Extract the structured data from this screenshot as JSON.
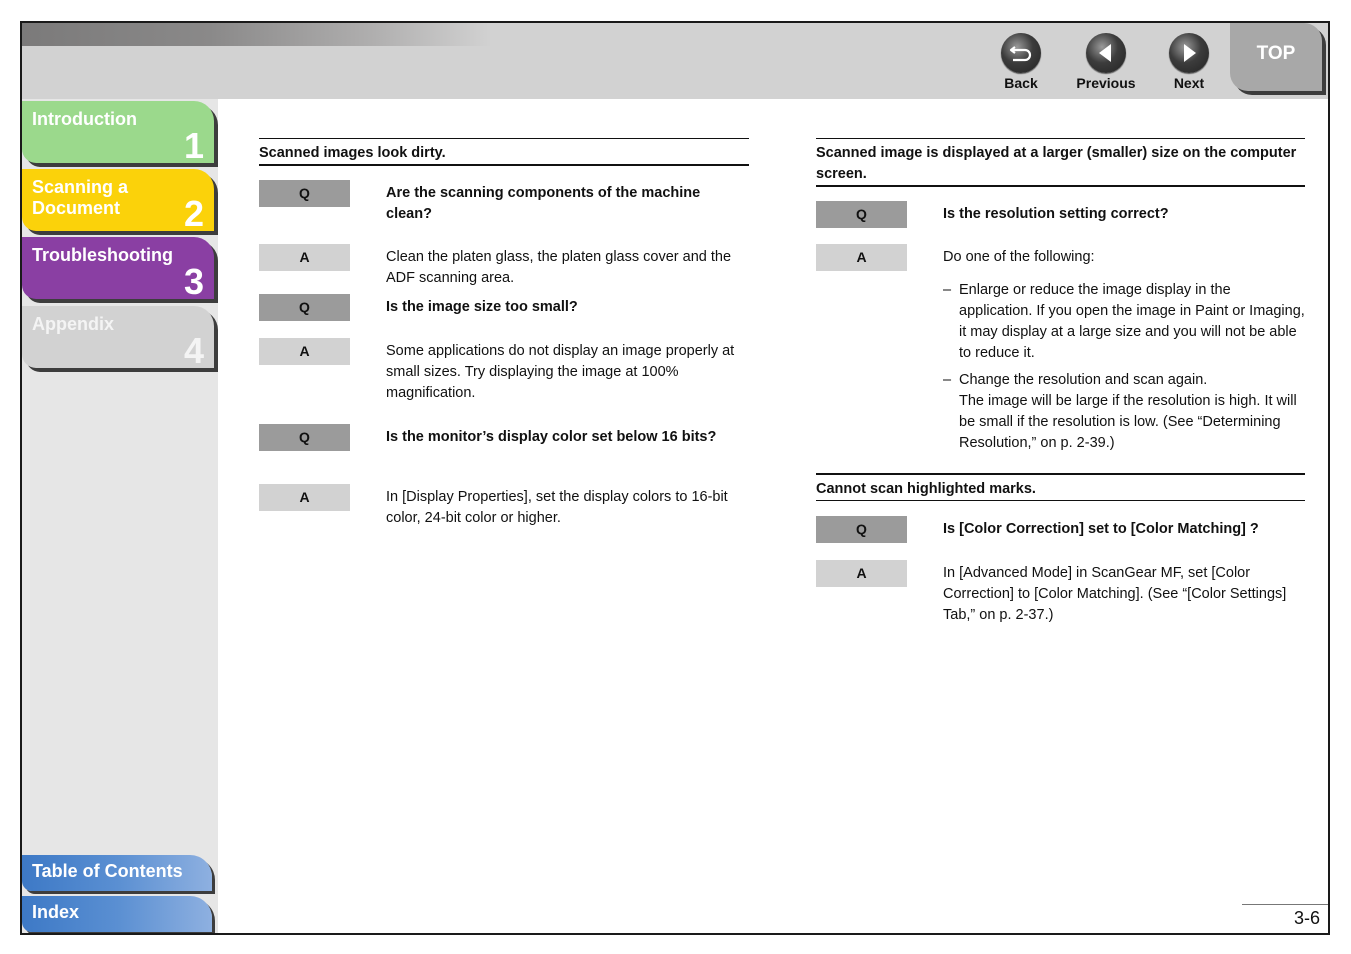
{
  "header": {
    "nav": [
      {
        "id": "back",
        "label": "Back",
        "icon": "back-arrow-icon"
      },
      {
        "id": "previous",
        "label": "Previous",
        "icon": "triangle-left-icon"
      },
      {
        "id": "next",
        "label": "Next",
        "icon": "triangle-right-icon"
      }
    ],
    "top_label": "TOP"
  },
  "sidebar": {
    "chapters": [
      {
        "title": "Introduction",
        "number": "1",
        "color": "#9bd98c"
      },
      {
        "title": "Scanning a Document",
        "title_line1": "Scanning a",
        "title_line2": "Document",
        "number": "2",
        "color": "#fbd20a"
      },
      {
        "title": "Troubleshooting",
        "number": "3",
        "color": "#8a3fa3"
      },
      {
        "title": "Appendix",
        "number": "4",
        "color": "#d2d2d2"
      }
    ],
    "table_of_contents": "Table of Contents",
    "index": "Index"
  },
  "content": {
    "left": {
      "heading": "Scanned images look dirty.",
      "items": [
        {
          "tag": "Q",
          "text": "Are the scanning components of the machine clean?"
        },
        {
          "tag": "A",
          "text": "Clean the platen glass, the platen glass cover and the ADF scanning area."
        },
        {
          "tag": "Q",
          "text": "Is the image size too small?"
        },
        {
          "tag": "A",
          "text": "Some applications do not display an image properly at small sizes. Try displaying the image at 100% magnification."
        },
        {
          "tag": "Q",
          "text": "Is the monitor’s display color set below 16 bits?"
        },
        {
          "tag": "A",
          "text": "In [Display Properties], set the display colors to 16-bit color, 24-bit color or higher."
        }
      ]
    },
    "right": {
      "section1": {
        "heading": "Scanned image is displayed at a larger (smaller) size on the computer screen.",
        "q": {
          "tag": "Q",
          "text": "Is the resolution setting correct?"
        },
        "a": {
          "tag": "A",
          "text": "Do one of the following:"
        },
        "bullets": [
          {
            "dash": "–",
            "text": "Enlarge or reduce the image display in the application. If you open the image in Paint or Imaging, it may display at a large size and you will not be able to reduce it."
          },
          {
            "dash": "–",
            "text": "Change the resolution and scan again.",
            "subtext": "The image will be large if the resolution is high. It will be small if the resolution is low. (See “Determining Resolution,” on p. 2-39.)"
          }
        ]
      },
      "section2": {
        "heading": "Cannot scan highlighted marks.",
        "q": {
          "tag": "Q",
          "text": "Is [Color Correction] set to [Color Matching] ?"
        },
        "a": {
          "tag": "A",
          "text": "In [Advanced Mode] in ScanGear MF, set [Color Correction] to [Color Matching]. (See “[Color Settings] Tab,” on p. 2-37.)"
        }
      }
    }
  },
  "footer": {
    "page_number": "3-6"
  }
}
